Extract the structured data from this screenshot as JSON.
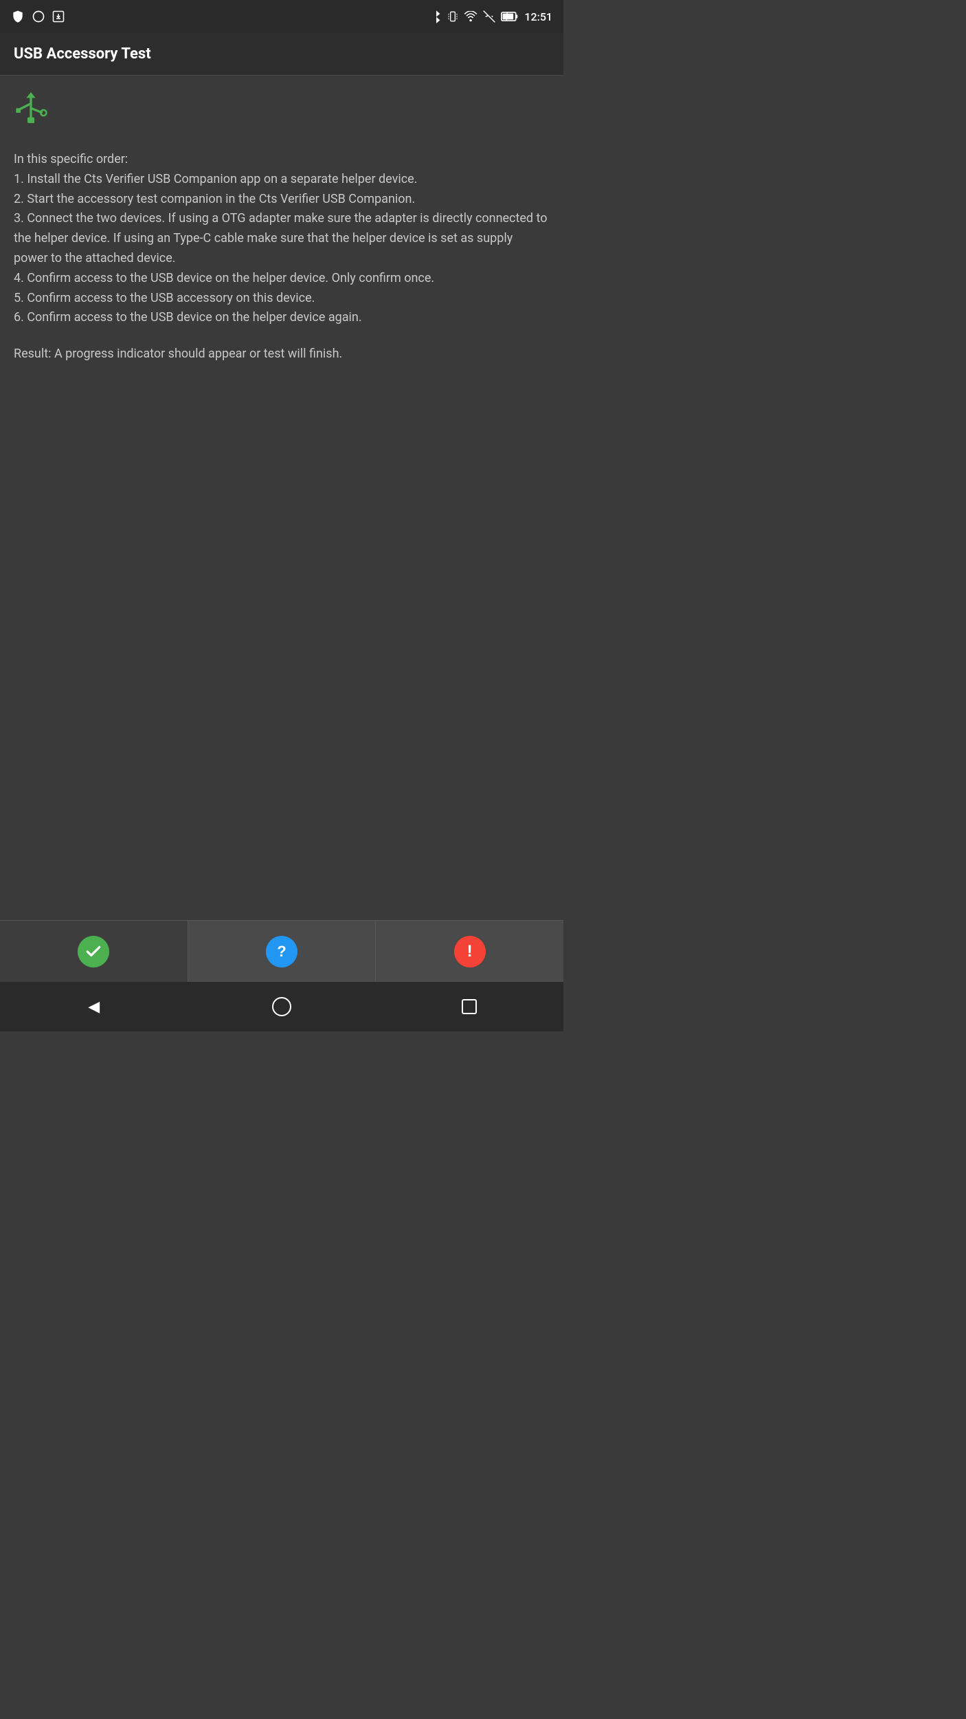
{
  "status_bar": {
    "time": "12:51",
    "icons": {
      "bluetooth": "BT",
      "vibrate": "VIB",
      "wifi": "WIFI",
      "signal": "SIG",
      "battery": "BAT"
    }
  },
  "toolbar": {
    "title": "USB Accessory Test"
  },
  "content": {
    "usb_icon_label": "USB",
    "instructions": "In this specific order:\n1. Install the Cts Verifier USB Companion app on a separate helper device.\n2. Start the accessory test companion in the Cts Verifier USB Companion.\n3. Connect the two devices. If using a OTG adapter make sure the adapter is directly connected to the helper device. If using an Type-C cable make sure that the helper device is set as supply power to the attached device.\n4. Confirm access to the USB device on the helper device. Only confirm once.\n5. Confirm access to the USB accessory on this device.\n6. Confirm access to the USB device on the helper device again.",
    "result": "Result: A progress indicator should appear or test will finish."
  },
  "bottom_buttons": {
    "pass_label": "✓",
    "info_label": "?",
    "fail_label": "!"
  },
  "nav_bar": {
    "back_label": "◀",
    "home_label": "○",
    "recent_label": "□"
  }
}
